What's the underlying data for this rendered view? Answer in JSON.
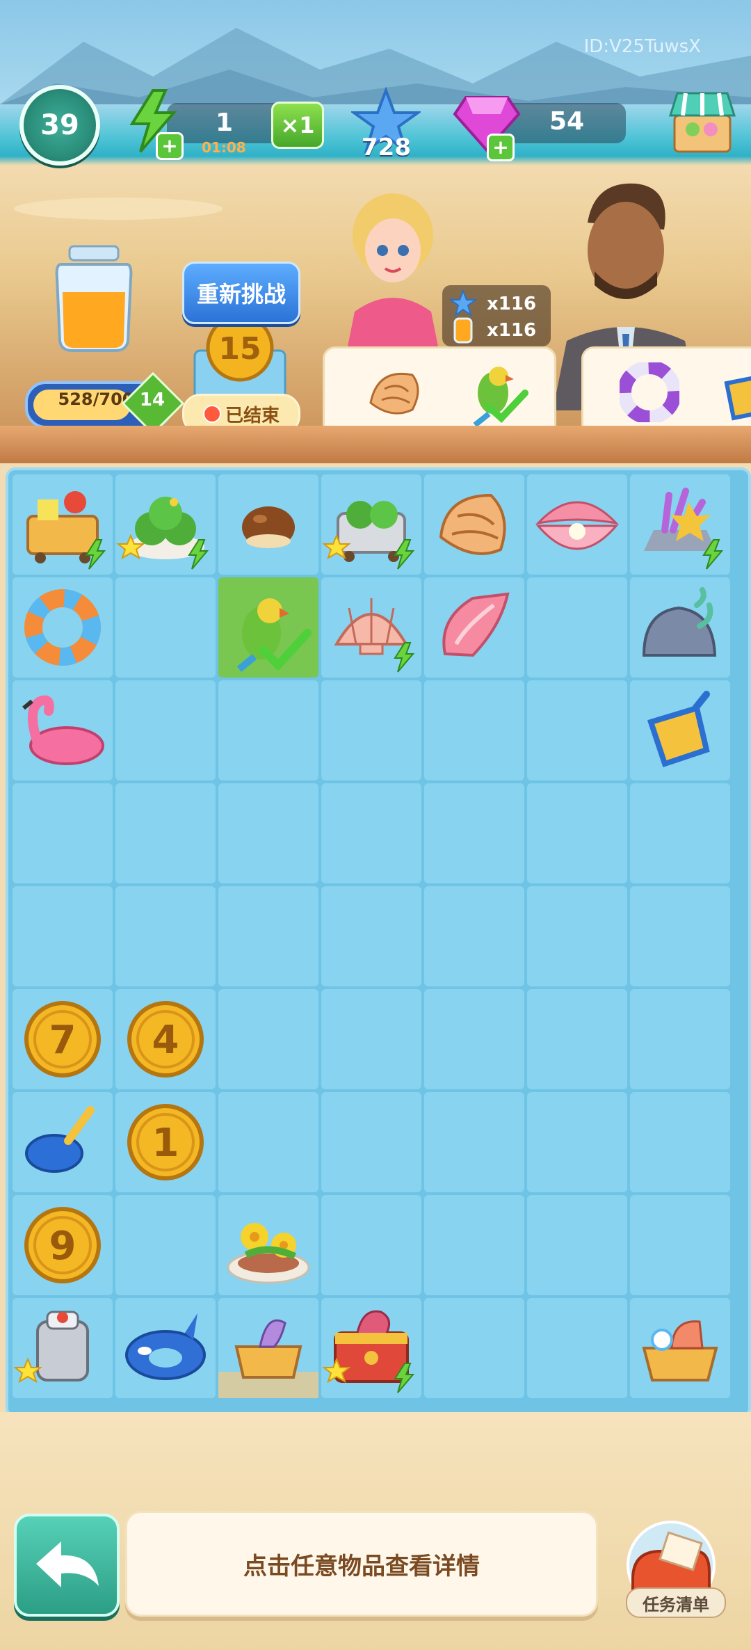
{
  "hud": {
    "player_id": "ID:V25TuwsX",
    "level": "39",
    "energy": "1",
    "energy_timer": "01:08",
    "multiplier": "×1",
    "stars": "728",
    "gems": "54"
  },
  "jar": {
    "progress_text": "528/700",
    "progress_fraction": 0.754,
    "level": "14"
  },
  "challenge": {
    "retry_label": "重新挑战",
    "coin_number": "15",
    "status": "已结束"
  },
  "orders": [
    {
      "reward_star": "x116",
      "reward_jar": "x116",
      "items": [
        "conch-shell",
        "parrot"
      ],
      "completed_item": "parrot"
    },
    {
      "items": [
        "life-ring",
        "sand-bucket"
      ]
    }
  ],
  "board": {
    "columns": 7,
    "rows": 9,
    "items": [
      {
        "r": 0,
        "c": 0,
        "item": "beach-cart",
        "energy": true
      },
      {
        "r": 0,
        "c": 1,
        "item": "cactus-pot",
        "star": true,
        "energy": true
      },
      {
        "r": 0,
        "c": 2,
        "item": "chestnut"
      },
      {
        "r": 0,
        "c": 3,
        "item": "cactus-cart",
        "star": true,
        "energy": true
      },
      {
        "r": 0,
        "c": 4,
        "item": "conch-shell"
      },
      {
        "r": 0,
        "c": 5,
        "item": "pearl-clam"
      },
      {
        "r": 0,
        "c": 6,
        "item": "coral-reef",
        "energy": true
      },
      {
        "r": 1,
        "c": 0,
        "item": "swim-ring"
      },
      {
        "r": 1,
        "c": 2,
        "item": "parrot",
        "selected": true
      },
      {
        "r": 1,
        "c": 3,
        "item": "scallop-shell",
        "energy": true
      },
      {
        "r": 1,
        "c": 4,
        "item": "spiral-shell"
      },
      {
        "r": 1,
        "c": 6,
        "item": "rock-seaweed"
      },
      {
        "r": 2,
        "c": 0,
        "item": "flamingo-float"
      },
      {
        "r": 2,
        "c": 6,
        "item": "sand-shovel"
      },
      {
        "r": 5,
        "c": 0,
        "item": "coin",
        "value": "7"
      },
      {
        "r": 5,
        "c": 1,
        "item": "coin",
        "value": "4"
      },
      {
        "r": 6,
        "c": 0,
        "item": "spade"
      },
      {
        "r": 6,
        "c": 1,
        "item": "coin",
        "value": "1"
      },
      {
        "r": 7,
        "c": 0,
        "item": "coin",
        "value": "9"
      },
      {
        "r": 7,
        "c": 2,
        "item": "flower-pot"
      },
      {
        "r": 8,
        "c": 0,
        "item": "juicer",
        "star": true
      },
      {
        "r": 8,
        "c": 1,
        "item": "orca-float"
      },
      {
        "r": 8,
        "c": 2,
        "item": "sand-box"
      },
      {
        "r": 8,
        "c": 3,
        "item": "treasure-chest",
        "star": true,
        "energy": true
      },
      {
        "r": 8,
        "c": 6,
        "item": "beach-basket"
      }
    ]
  },
  "footer": {
    "hint": "点击任意物品查看详情",
    "task_list": "任务清单"
  }
}
